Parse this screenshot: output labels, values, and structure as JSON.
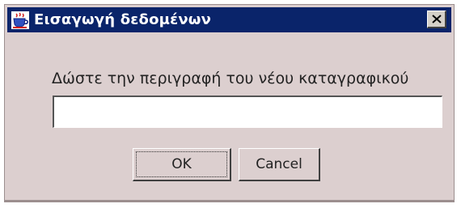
{
  "window": {
    "title": "Εισαγωγή δεδομένων",
    "app_icon": "java-coffee-cup-icon",
    "close_icon": "close-x-icon"
  },
  "dialog": {
    "prompt": "Δώστε την περιγραφή του νέου καταγραφικού",
    "input_value": "",
    "input_placeholder": ""
  },
  "buttons": {
    "ok_label": "OK",
    "cancel_label": "Cancel"
  },
  "colors": {
    "titlebar": "#0a246a",
    "dialog_background": "#dccfcf",
    "title_text": "#ffffff"
  }
}
